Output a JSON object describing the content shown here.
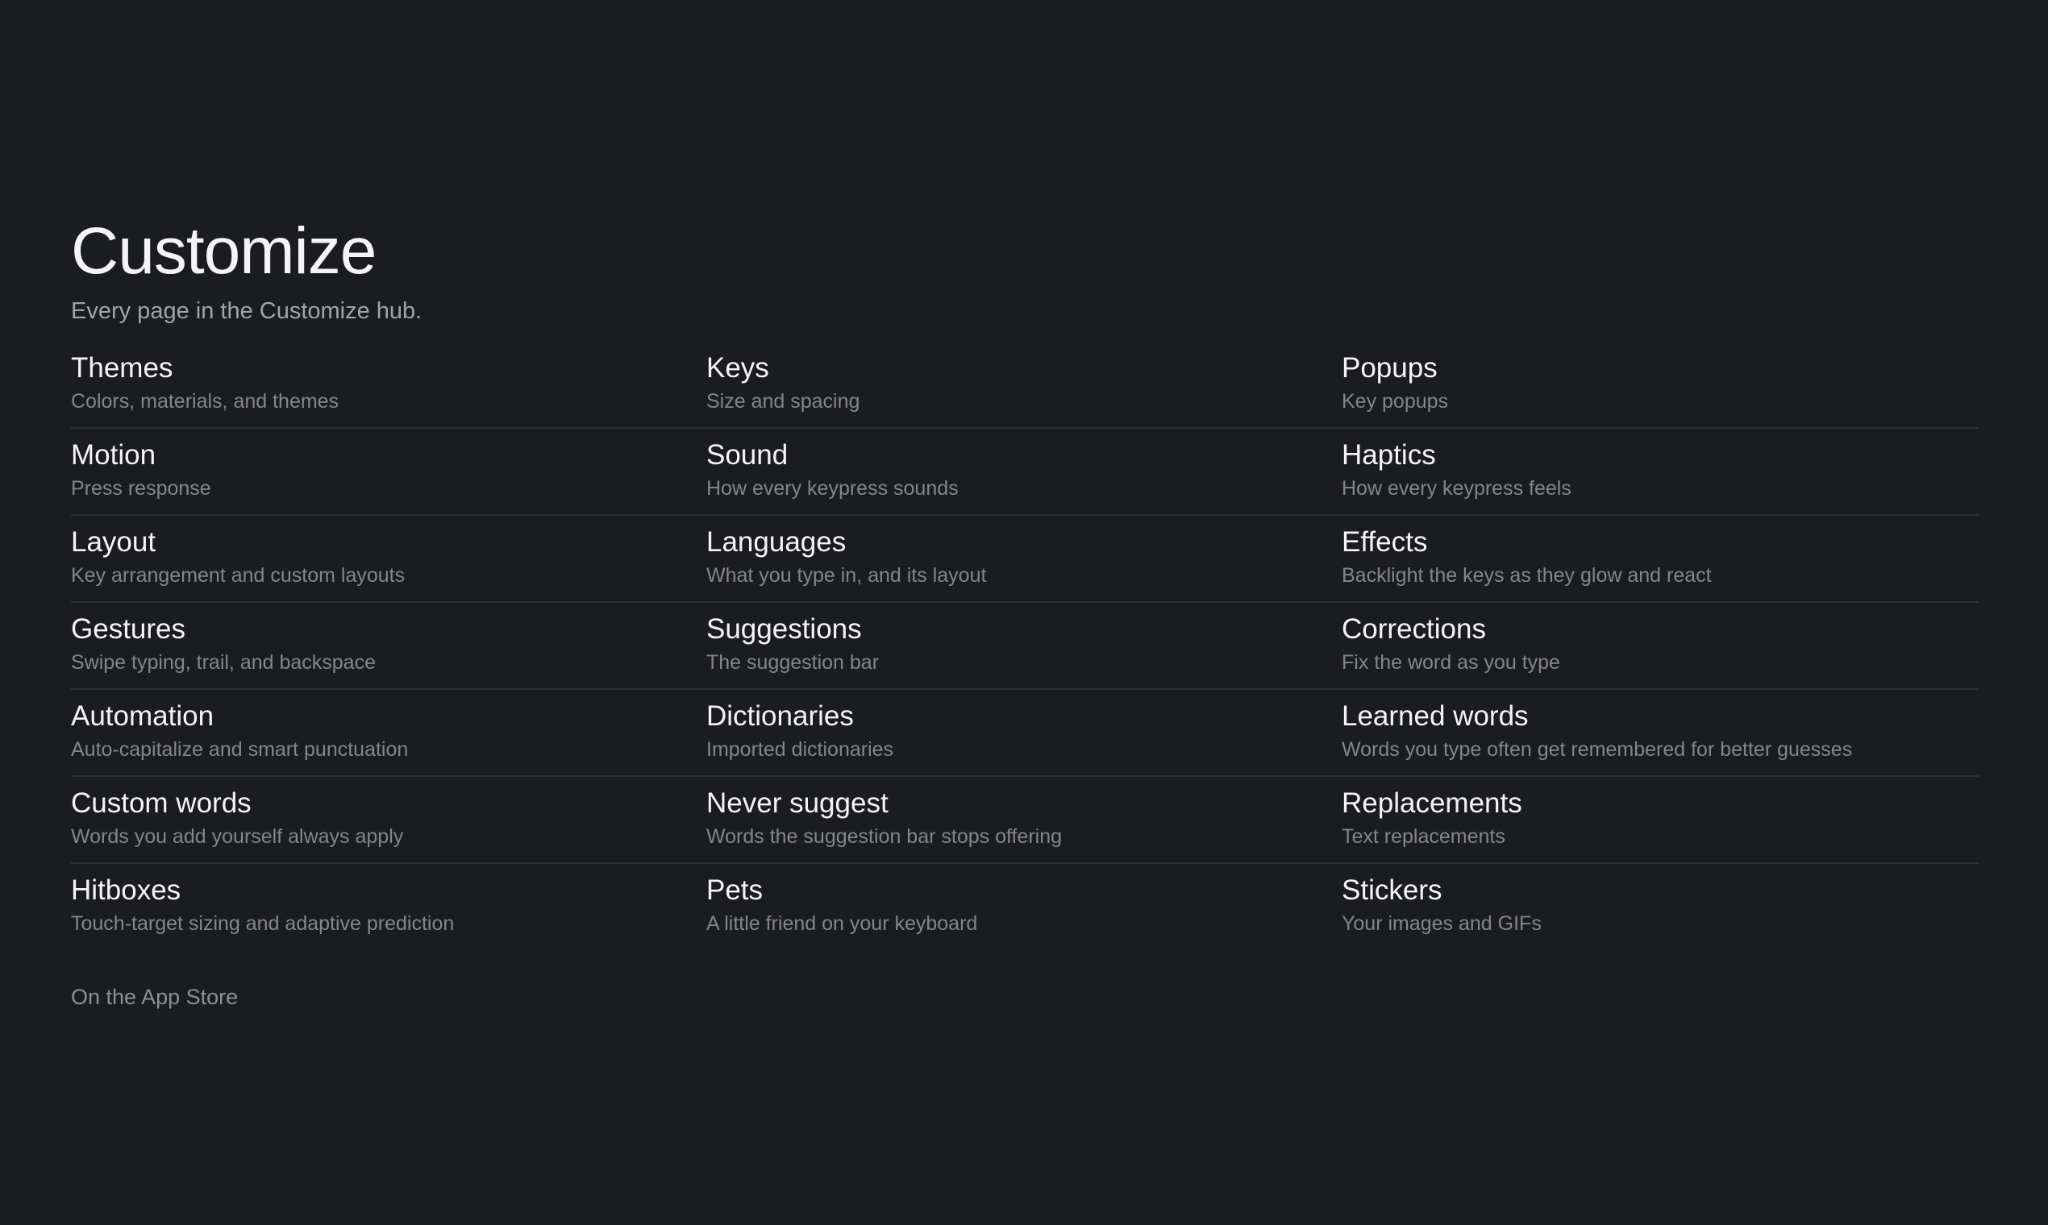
{
  "header": {
    "title": "Customize",
    "subtitle": "Every page in the Customize hub."
  },
  "items": [
    {
      "title": "Themes",
      "desc": "Colors, materials, and themes"
    },
    {
      "title": "Keys",
      "desc": "Size and spacing"
    },
    {
      "title": "Popups",
      "desc": "Key popups"
    },
    {
      "title": "Motion",
      "desc": "Press response"
    },
    {
      "title": "Sound",
      "desc": "How every keypress sounds"
    },
    {
      "title": "Haptics",
      "desc": "How every keypress feels"
    },
    {
      "title": "Layout",
      "desc": "Key arrangement and custom layouts"
    },
    {
      "title": "Languages",
      "desc": "What you type in, and its layout"
    },
    {
      "title": "Effects",
      "desc": "Backlight the keys as they glow and react"
    },
    {
      "title": "Gestures",
      "desc": "Swipe typing, trail, and backspace"
    },
    {
      "title": "Suggestions",
      "desc": "The suggestion bar"
    },
    {
      "title": "Corrections",
      "desc": "Fix the word as you type"
    },
    {
      "title": "Automation",
      "desc": "Auto-capitalize and smart punctuation"
    },
    {
      "title": "Dictionaries",
      "desc": "Imported dictionaries"
    },
    {
      "title": "Learned words",
      "desc": "Words you type often get remembered for better guesses"
    },
    {
      "title": "Custom words",
      "desc": "Words you add yourself always apply"
    },
    {
      "title": "Never suggest",
      "desc": "Words the suggestion bar stops offering"
    },
    {
      "title": "Replacements",
      "desc": "Text replacements"
    },
    {
      "title": "Hitboxes",
      "desc": "Touch-target sizing and adaptive prediction"
    },
    {
      "title": "Pets",
      "desc": "A little friend on your keyboard"
    },
    {
      "title": "Stickers",
      "desc": "Your images and GIFs"
    }
  ],
  "footer": {
    "store_link": "On the App Store"
  }
}
